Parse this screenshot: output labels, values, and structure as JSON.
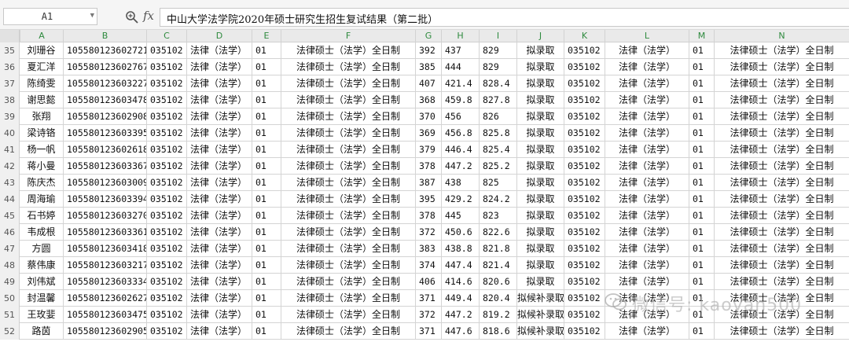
{
  "formula_bar": {
    "cell_ref": "A1",
    "formula": "中山大学法学院2020年硕士研究生招生复试结果（第二批）"
  },
  "columns": [
    "A",
    "B",
    "C",
    "D",
    "E",
    "F",
    "G",
    "H",
    "I",
    "J",
    "K",
    "L",
    "M",
    "N"
  ],
  "rows": [
    {
      "num": "35",
      "name": "刘珊谷",
      "id": "105580123602721",
      "code": "035102",
      "major": "法律（法学）",
      "dir": "01",
      "type": "法律硕士（法学）全日制",
      "s1": "392",
      "s2": "437",
      "total": "829",
      "status": "拟录取",
      "code2": "035102",
      "major2": "法律（法学）",
      "dir2": "01",
      "type2": "法律硕士（法学）全日制"
    },
    {
      "num": "36",
      "name": "夏汇洋",
      "id": "105580123602767",
      "code": "035102",
      "major": "法律（法学）",
      "dir": "01",
      "type": "法律硕士（法学）全日制",
      "s1": "385",
      "s2": "444",
      "total": "829",
      "status": "拟录取",
      "code2": "035102",
      "major2": "法律（法学）",
      "dir2": "01",
      "type2": "法律硕士（法学）全日制"
    },
    {
      "num": "37",
      "name": "陈绮雯",
      "id": "105580123603227",
      "code": "035102",
      "major": "法律（法学）",
      "dir": "01",
      "type": "法律硕士（法学）全日制",
      "s1": "407",
      "s2": "421.4",
      "total": "828.4",
      "status": "拟录取",
      "code2": "035102",
      "major2": "法律（法学）",
      "dir2": "01",
      "type2": "法律硕士（法学）全日制"
    },
    {
      "num": "38",
      "name": "谢思懿",
      "id": "105580123603478",
      "code": "035102",
      "major": "法律（法学）",
      "dir": "01",
      "type": "法律硕士（法学）全日制",
      "s1": "368",
      "s2": "459.8",
      "total": "827.8",
      "status": "拟录取",
      "code2": "035102",
      "major2": "法律（法学）",
      "dir2": "01",
      "type2": "法律硕士（法学）全日制"
    },
    {
      "num": "39",
      "name": "张翔",
      "id": "105580123602908",
      "code": "035102",
      "major": "法律（法学）",
      "dir": "01",
      "type": "法律硕士（法学）全日制",
      "s1": "370",
      "s2": "456",
      "total": "826",
      "status": "拟录取",
      "code2": "035102",
      "major2": "法律（法学）",
      "dir2": "01",
      "type2": "法律硕士（法学）全日制"
    },
    {
      "num": "40",
      "name": "梁诗铬",
      "id": "105580123603395",
      "code": "035102",
      "major": "法律（法学）",
      "dir": "01",
      "type": "法律硕士（法学）全日制",
      "s1": "369",
      "s2": "456.8",
      "total": "825.8",
      "status": "拟录取",
      "code2": "035102",
      "major2": "法律（法学）",
      "dir2": "01",
      "type2": "法律硕士（法学）全日制"
    },
    {
      "num": "41",
      "name": "杨一帆",
      "id": "105580123602618",
      "code": "035102",
      "major": "法律（法学）",
      "dir": "01",
      "type": "法律硕士（法学）全日制",
      "s1": "379",
      "s2": "446.4",
      "total": "825.4",
      "status": "拟录取",
      "code2": "035102",
      "major2": "法律（法学）",
      "dir2": "01",
      "type2": "法律硕士（法学）全日制"
    },
    {
      "num": "42",
      "name": "蒋小曼",
      "id": "105580123603367",
      "code": "035102",
      "major": "法律（法学）",
      "dir": "01",
      "type": "法律硕士（法学）全日制",
      "s1": "378",
      "s2": "447.2",
      "total": "825.2",
      "status": "拟录取",
      "code2": "035102",
      "major2": "法律（法学）",
      "dir2": "01",
      "type2": "法律硕士（法学）全日制"
    },
    {
      "num": "43",
      "name": "陈庆杰",
      "id": "105580123603009",
      "code": "035102",
      "major": "法律（法学）",
      "dir": "01",
      "type": "法律硕士（法学）全日制",
      "s1": "387",
      "s2": "438",
      "total": "825",
      "status": "拟录取",
      "code2": "035102",
      "major2": "法律（法学）",
      "dir2": "01",
      "type2": "法律硕士（法学）全日制"
    },
    {
      "num": "44",
      "name": "周海瑜",
      "id": "105580123603394",
      "code": "035102",
      "major": "法律（法学）",
      "dir": "01",
      "type": "法律硕士（法学）全日制",
      "s1": "395",
      "s2": "429.2",
      "total": "824.2",
      "status": "拟录取",
      "code2": "035102",
      "major2": "法律（法学）",
      "dir2": "01",
      "type2": "法律硕士（法学）全日制"
    },
    {
      "num": "45",
      "name": "石书婷",
      "id": "105580123603270",
      "code": "035102",
      "major": "法律（法学）",
      "dir": "01",
      "type": "法律硕士（法学）全日制",
      "s1": "378",
      "s2": "445",
      "total": "823",
      "status": "拟录取",
      "code2": "035102",
      "major2": "法律（法学）",
      "dir2": "01",
      "type2": "法律硕士（法学）全日制"
    },
    {
      "num": "46",
      "name": "韦成根",
      "id": "105580123603361",
      "code": "035102",
      "major": "法律（法学）",
      "dir": "01",
      "type": "法律硕士（法学）全日制",
      "s1": "372",
      "s2": "450.6",
      "total": "822.6",
      "status": "拟录取",
      "code2": "035102",
      "major2": "法律（法学）",
      "dir2": "01",
      "type2": "法律硕士（法学）全日制"
    },
    {
      "num": "47",
      "name": "方圆",
      "id": "105580123603418",
      "code": "035102",
      "major": "法律（法学）",
      "dir": "01",
      "type": "法律硕士（法学）全日制",
      "s1": "383",
      "s2": "438.8",
      "total": "821.8",
      "status": "拟录取",
      "code2": "035102",
      "major2": "法律（法学）",
      "dir2": "01",
      "type2": "法律硕士（法学）全日制"
    },
    {
      "num": "48",
      "name": "蔡伟康",
      "id": "105580123603217",
      "code": "035102",
      "major": "法律（法学）",
      "dir": "01",
      "type": "法律硕士（法学）全日制",
      "s1": "374",
      "s2": "447.4",
      "total": "821.4",
      "status": "拟录取",
      "code2": "035102",
      "major2": "法律（法学）",
      "dir2": "01",
      "type2": "法律硕士（法学）全日制"
    },
    {
      "num": "49",
      "name": "刘伟斌",
      "id": "105580123603334",
      "code": "035102",
      "major": "法律（法学）",
      "dir": "01",
      "type": "法律硕士（法学）全日制",
      "s1": "406",
      "s2": "414.6",
      "total": "820.6",
      "status": "拟录取",
      "code2": "035102",
      "major2": "法律（法学）",
      "dir2": "01",
      "type2": "法律硕士（法学）全日制"
    },
    {
      "num": "50",
      "name": "封温馨",
      "id": "105580123602627",
      "code": "035102",
      "major": "法律（法学）",
      "dir": "01",
      "type": "法律硕士（法学）全日制",
      "s1": "371",
      "s2": "449.4",
      "total": "820.4",
      "status": "拟候补录取",
      "code2": "035102",
      "major2": "法律（法学）",
      "dir2": "01",
      "type2": "法律硕士（法学）全日制"
    },
    {
      "num": "51",
      "name": "王玫婓",
      "id": "105580123603475",
      "code": "035102",
      "major": "法律（法学）",
      "dir": "01",
      "type": "法律硕士（法学）全日制",
      "s1": "372",
      "s2": "447.2",
      "total": "819.2",
      "status": "拟候补录取",
      "code2": "035102",
      "major2": "法律（法学）",
      "dir2": "01",
      "type2": "法律硕士（法学）全日制"
    },
    {
      "num": "52",
      "name": "路茵",
      "id": "105580123602905",
      "code": "035102",
      "major": "法律（法学）",
      "dir": "01",
      "type": "法律硕士（法学）全日制",
      "s1": "371",
      "s2": "447.6",
      "total": "818.6",
      "status": "拟候补录取",
      "code2": "035102",
      "major2": "法律（法学）",
      "dir2": "01",
      "type2": "法律硕士（法学）全日制"
    }
  ],
  "watermark": "微信号: kaoyan500"
}
